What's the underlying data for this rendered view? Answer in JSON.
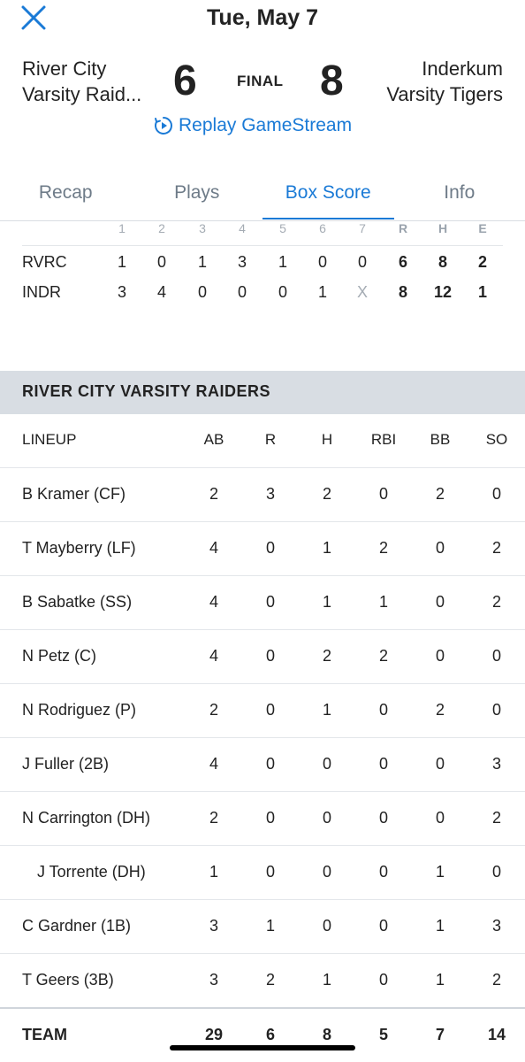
{
  "header": {
    "date": "Tue, May 7",
    "status": "FINAL",
    "replay_label": "Replay GameStream"
  },
  "teams": {
    "away": {
      "line1": "River City",
      "line2": "Varsity Raid...",
      "score": "6"
    },
    "home": {
      "line1": "Inderkum",
      "line2": "Varsity Tigers",
      "score": "8"
    }
  },
  "tabs": [
    "Recap",
    "Plays",
    "Box Score",
    "Info"
  ],
  "active_tab": "Box Score",
  "linescore": {
    "headers": [
      "1",
      "2",
      "3",
      "4",
      "5",
      "6",
      "7",
      "R",
      "H",
      "E"
    ],
    "rows": [
      {
        "team": "RVRC",
        "innings": [
          "1",
          "0",
          "1",
          "3",
          "1",
          "0",
          "0"
        ],
        "r": "6",
        "h": "8",
        "e": "2"
      },
      {
        "team": "INDR",
        "innings": [
          "3",
          "4",
          "0",
          "0",
          "0",
          "1",
          "X"
        ],
        "r": "8",
        "h": "12",
        "e": "1"
      }
    ]
  },
  "box": {
    "section_title": "RIVER CITY VARSITY RAIDERS",
    "columns": [
      "LINEUP",
      "AB",
      "R",
      "H",
      "RBI",
      "BB",
      "SO"
    ],
    "players": [
      {
        "name": "B Kramer (CF)",
        "sub": false,
        "stats": [
          "2",
          "3",
          "2",
          "0",
          "2",
          "0"
        ]
      },
      {
        "name": "T Mayberry (LF)",
        "sub": false,
        "stats": [
          "4",
          "0",
          "1",
          "2",
          "0",
          "2"
        ]
      },
      {
        "name": "B Sabatke (SS)",
        "sub": false,
        "stats": [
          "4",
          "0",
          "1",
          "1",
          "0",
          "2"
        ]
      },
      {
        "name": "N Petz (C)",
        "sub": false,
        "stats": [
          "4",
          "0",
          "2",
          "2",
          "0",
          "0"
        ]
      },
      {
        "name": "N Rodriguez (P)",
        "sub": false,
        "stats": [
          "2",
          "0",
          "1",
          "0",
          "2",
          "0"
        ]
      },
      {
        "name": "J Fuller (2B)",
        "sub": false,
        "stats": [
          "4",
          "0",
          "0",
          "0",
          "0",
          "3"
        ]
      },
      {
        "name": "N Carrington (DH)",
        "sub": false,
        "stats": [
          "2",
          "0",
          "0",
          "0",
          "0",
          "2"
        ]
      },
      {
        "name": "J Torrente (DH)",
        "sub": true,
        "stats": [
          "1",
          "0",
          "0",
          "0",
          "1",
          "0"
        ]
      },
      {
        "name": "C Gardner (1B)",
        "sub": false,
        "stats": [
          "3",
          "1",
          "0",
          "0",
          "1",
          "3"
        ]
      },
      {
        "name": "T Geers (3B)",
        "sub": false,
        "stats": [
          "3",
          "2",
          "1",
          "0",
          "1",
          "2"
        ]
      }
    ],
    "team_totals": {
      "label": "TEAM",
      "stats": [
        "29",
        "6",
        "8",
        "5",
        "7",
        "14"
      ]
    }
  },
  "colors": {
    "accent": "#1a7ad6",
    "section_bg": "#d8dde3"
  }
}
